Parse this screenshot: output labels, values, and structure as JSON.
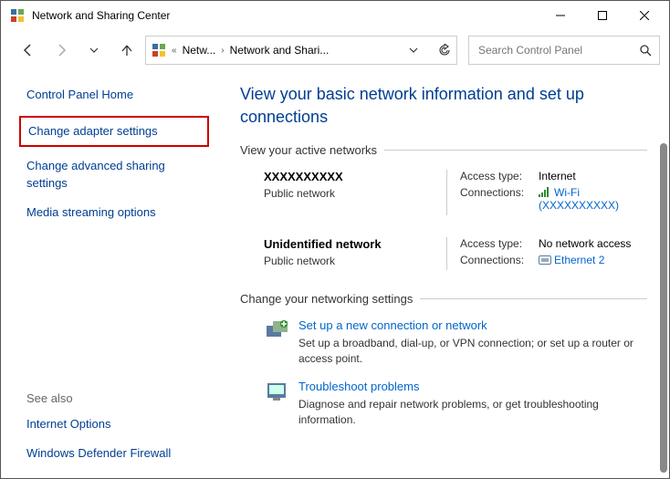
{
  "titlebar": {
    "title": "Network and Sharing Center"
  },
  "address": {
    "seg1": "Netw...",
    "seg2": "Network and Shari..."
  },
  "search": {
    "placeholder": "Search Control Panel"
  },
  "sidebar": {
    "home": "Control Panel Home",
    "adapter": "Change adapter settings",
    "advanced": "Change advanced sharing settings",
    "media": "Media streaming options",
    "seealso": "See also",
    "inet": "Internet Options",
    "firewall": "Windows Defender Firewall"
  },
  "main": {
    "heading": "View your basic network information and set up connections",
    "active_hdr": "View your active networks",
    "settings_hdr": "Change your networking settings",
    "labels": {
      "access": "Access type:",
      "conn": "Connections:"
    }
  },
  "networks": [
    {
      "name": "XXXXXXXXXX",
      "type": "Public network",
      "access": "Internet",
      "conn_label": "Wi-Fi (XXXXXXXXXX)",
      "icon": "wifi"
    },
    {
      "name": "Unidentified network",
      "type": "Public network",
      "access": "No network access",
      "conn_label": "Ethernet 2",
      "icon": "eth"
    }
  ],
  "tasks": [
    {
      "title": "Set up a new connection or network",
      "desc": "Set up a broadband, dial-up, or VPN connection; or set up a router or access point."
    },
    {
      "title": "Troubleshoot problems",
      "desc": "Diagnose and repair network problems, or get troubleshooting information."
    }
  ]
}
